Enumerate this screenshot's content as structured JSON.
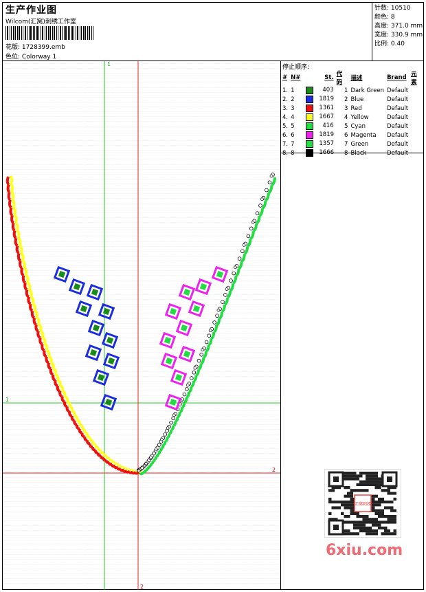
{
  "header": {
    "title": "生产作业图",
    "company": "Wilcom(汇窝)刺绣工作室",
    "design_label": "花版:",
    "design_value": "1728399.emb",
    "colorway_label": "色位:",
    "colorway_value": "Colorway 1"
  },
  "stats": {
    "stitches_label": "针数:",
    "stitches": "10510",
    "colors_label": "颜色:",
    "colors": "8",
    "height_label": "高度:",
    "height": "371.0 mm",
    "width_label": "宽度:",
    "width": "330.9 mm",
    "scale_label": "比例:",
    "scale": "0.40"
  },
  "stop_sequence": {
    "title": "停止顺序:",
    "headers": {
      "num": "#",
      "n": "N#",
      "st": "St.",
      "code": "代码",
      "desc": "描述",
      "brand": "Brand",
      "element": "元素"
    },
    "rows": [
      {
        "num": "1.",
        "n": "1",
        "color": "#1a8c1a",
        "st": "403",
        "code": "1",
        "desc": "Dark Green",
        "brand": "Default"
      },
      {
        "num": "2.",
        "n": "2",
        "color": "#1a2ee0",
        "st": "1819",
        "code": "2",
        "desc": "Blue",
        "brand": "Default"
      },
      {
        "num": "3.",
        "n": "3",
        "color": "#ee1111",
        "st": "1361",
        "code": "3",
        "desc": "Red",
        "brand": "Default"
      },
      {
        "num": "4.",
        "n": "4",
        "color": "#ffff22",
        "st": "1667",
        "code": "4",
        "desc": "Yellow",
        "brand": "Default"
      },
      {
        "num": "5.",
        "n": "5",
        "color": "#22dd44",
        "st": "416",
        "code": "5",
        "desc": "Cyan",
        "brand": "Default"
      },
      {
        "num": "6.",
        "n": "6",
        "color": "#ee22ee",
        "st": "1819",
        "code": "6",
        "desc": "Magenta",
        "brand": "Default"
      },
      {
        "num": "7.",
        "n": "7",
        "color": "#22dd44",
        "st": "1357",
        "code": "7",
        "desc": "Green",
        "brand": "Default"
      },
      {
        "num": "8.",
        "n": "8",
        "color": "#000000",
        "st": "1666",
        "code": "8",
        "desc": "Black",
        "brand": "Default"
      }
    ]
  },
  "guides": {
    "green_v": "1",
    "green_h": "1",
    "red_h": "2",
    "red_v": "2"
  },
  "watermark": "6xiu.com",
  "qr_caption": "汇窝刺绣"
}
